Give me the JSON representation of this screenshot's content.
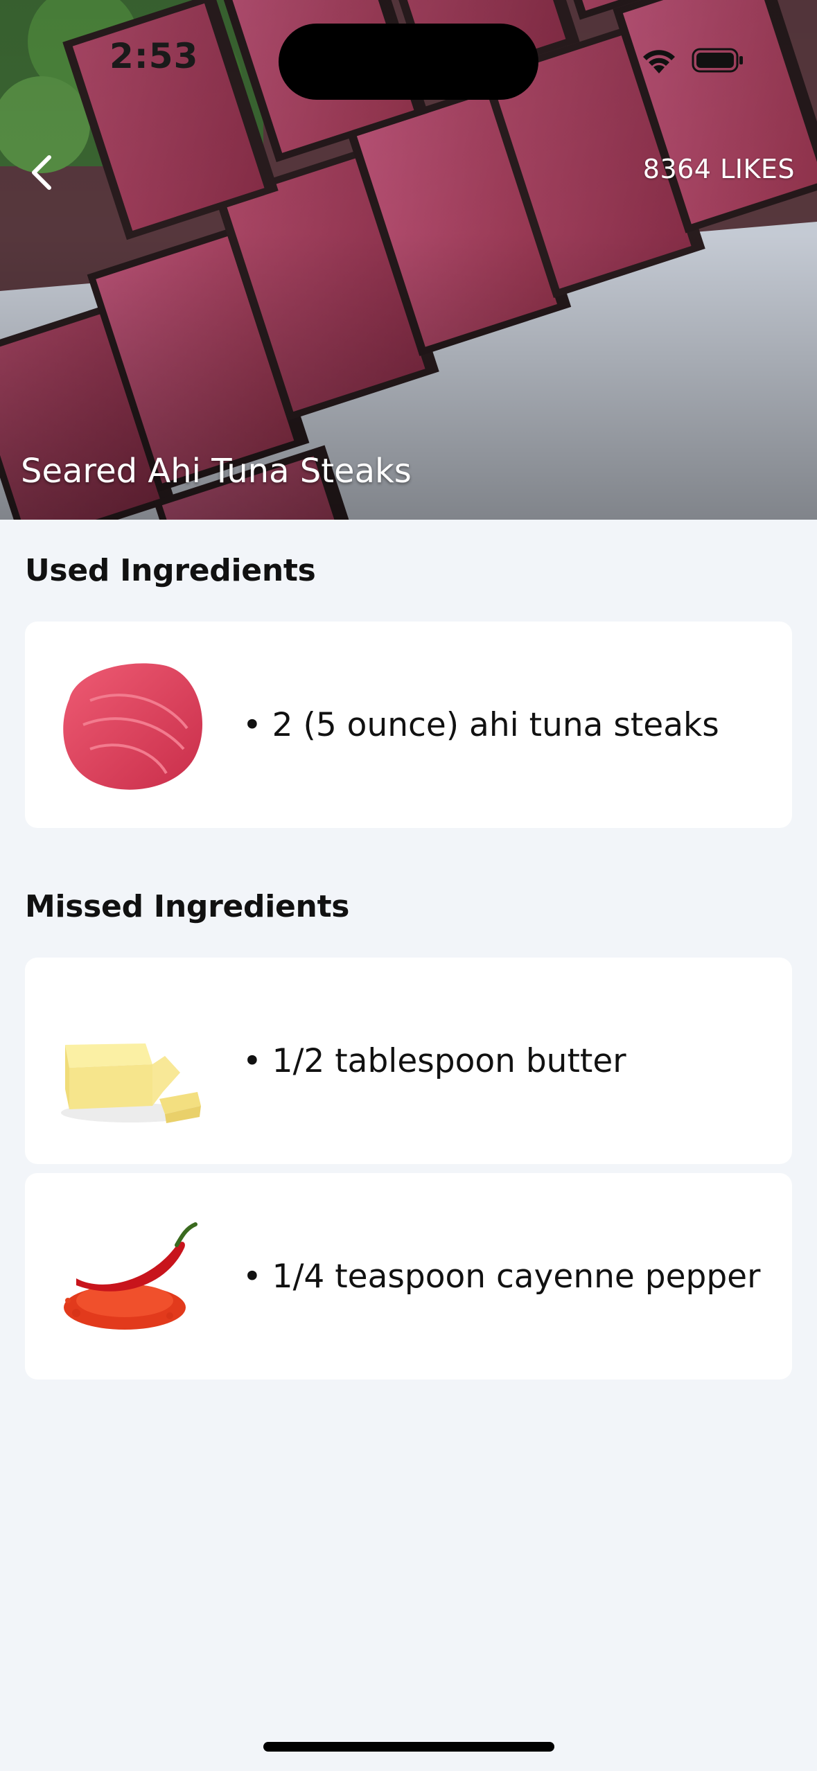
{
  "status": {
    "time": "2:53",
    "wifi_icon": "wifi-icon",
    "battery_icon": "battery-icon"
  },
  "header": {
    "back_icon": "chevron-left-icon",
    "likes": "8364 LIKES",
    "title": "Seared Ahi Tuna Steaks"
  },
  "sections": {
    "used": {
      "title": "Used Ingredients",
      "items": [
        {
          "text": "• 2 (5 ounce) ahi tuna steaks",
          "image": "tuna-steak-image"
        }
      ]
    },
    "missed": {
      "title": "Missed Ingredients",
      "items": [
        {
          "text": "• 1/2 tablespoon butter",
          "image": "butter-image"
        },
        {
          "text": "• 1/4 teaspoon cayenne pepper",
          "image": "cayenne-pepper-image"
        }
      ]
    }
  },
  "colors": {
    "background": "#f2f5f9",
    "card": "#ffffff",
    "overlay_text": "#ffffff"
  }
}
